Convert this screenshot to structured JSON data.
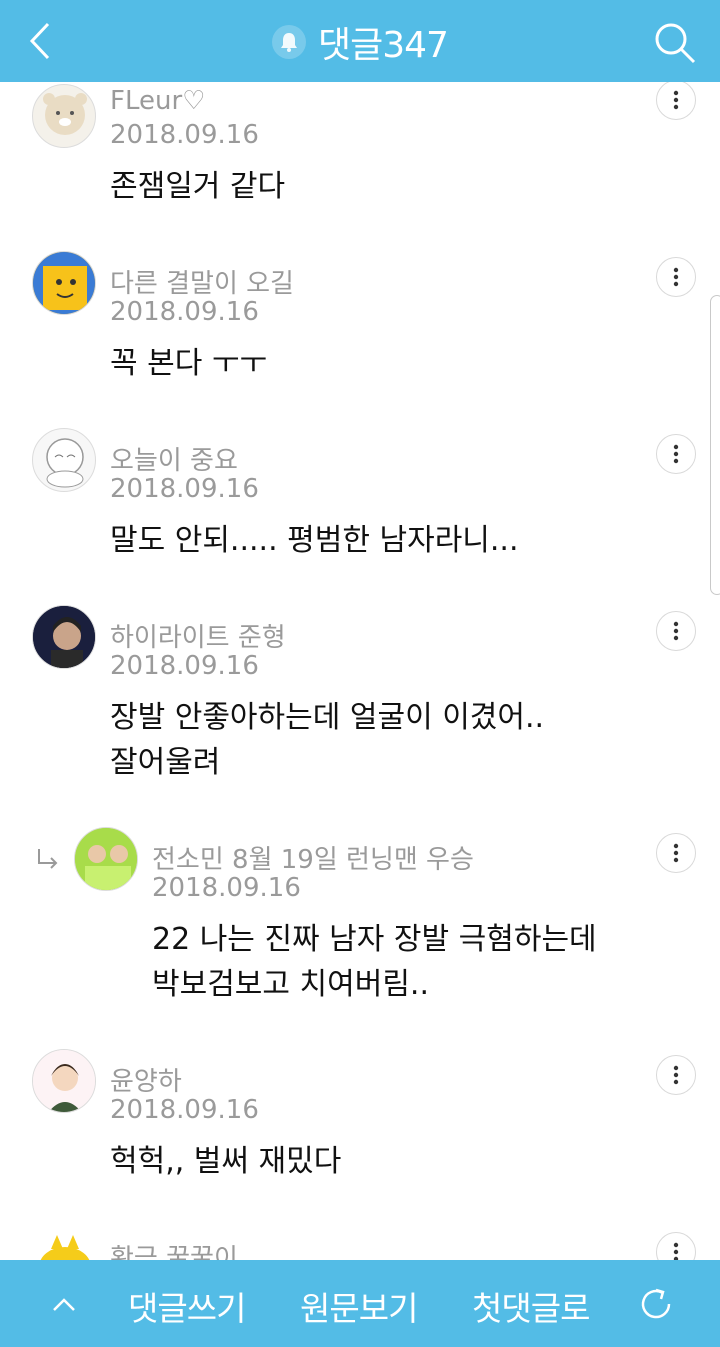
{
  "header": {
    "title": "댓글347",
    "colors": {
      "bar": "#53bce6"
    },
    "icons": {
      "back": "back-chevron-icon",
      "bell": "bell-icon",
      "search": "search-icon"
    }
  },
  "comments": [
    {
      "author": "FLeur♡",
      "date": "2018.09.16",
      "text": "존잼일거 같다",
      "reply": false,
      "avatar": "bear-character-avatar"
    },
    {
      "author": "다른 결말이 오길",
      "date": "2018.09.16",
      "text": "꼭 본다 ㅜㅜ",
      "reply": false,
      "avatar": "yellow-character-avatar"
    },
    {
      "author": "오늘이 중요",
      "date": "2018.09.16",
      "text": "말도 안되..... 평범한 남자라니...",
      "reply": false,
      "avatar": "sketch-character-avatar"
    },
    {
      "author": "하이라이트 준형",
      "date": "2018.09.16",
      "text": "장발 안좋아하는데 얼굴이 이겼어..\n잘어울려",
      "reply": false,
      "avatar": "photo-avatar"
    },
    {
      "author": "전소민 8월 19일 런닝맨 우승",
      "date": "2018.09.16",
      "text": "22 나는 진짜 남자 장발 극혐하는데\n박보검보고 치여버림..",
      "reply": true,
      "avatar": "green-photo-avatar"
    },
    {
      "author": "윤양하",
      "date": "2018.09.16",
      "text": "헉헉,, 벌써 재밌다",
      "reply": false,
      "avatar": "drawn-character-avatar"
    },
    {
      "author": "황금 꿀꿀이",
      "date": "",
      "text": "",
      "reply": false,
      "avatar": "golden-pig-avatar"
    }
  ],
  "bottom": {
    "write": "댓글쓰기",
    "original": "원문보기",
    "first": "첫댓글로",
    "icons": {
      "up": "chevron-up-icon",
      "refresh": "refresh-icon"
    }
  }
}
